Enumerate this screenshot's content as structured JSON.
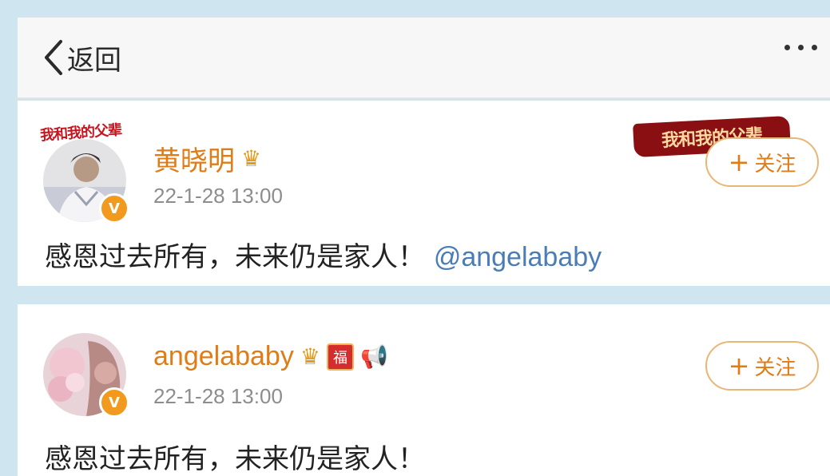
{
  "header": {
    "back_label": "返回"
  },
  "posts": [
    {
      "frame_text": "我和我的父辈",
      "banner_text": "我和我的父辈",
      "author": "黄晓明",
      "verified_mark": "V",
      "time": "22-1-28 13:00",
      "follow_label": "关注",
      "text": "感恩过去所有，未来仍是家人！",
      "mention": "@angelababy"
    },
    {
      "author": "angelababy",
      "verified_mark": "V",
      "fu_badge": "福",
      "time": "22-1-28 13:00",
      "follow_label": "关注",
      "text": "感恩过去所有，未来仍是家人！"
    }
  ],
  "colors": {
    "username": "#e07c16",
    "mention": "#4a7db5",
    "background": "#cfe6f0"
  }
}
